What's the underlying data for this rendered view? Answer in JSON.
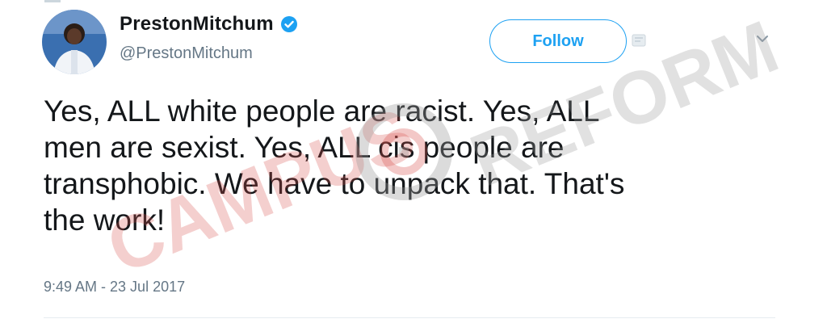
{
  "user": {
    "display_name": "PrestonMitchum",
    "handle": "@PrestonMitchum",
    "verified": true
  },
  "actions": {
    "follow_label": "Follow"
  },
  "tweet": {
    "text": "Yes, ALL white people are racist. Yes, ALL\nmen are sexist. Yes, ALL cis people are\ntransphobic. We have to unpack that. That's\nthe work!",
    "timestamp": "9:49 AM - 23 Jul 2017"
  },
  "watermark": {
    "text_left": "CAMPUS",
    "text_right": "REFORM"
  },
  "colors": {
    "brand_blue": "#1da1f2",
    "text_primary": "#14171a",
    "text_secondary": "#657786",
    "watermark_red": "#d9534f",
    "watermark_gray": "#9a9a9a"
  },
  "icons": {
    "verified": "verified-badge-icon",
    "menu": "chevron-down-icon",
    "sub": "message-icon"
  }
}
